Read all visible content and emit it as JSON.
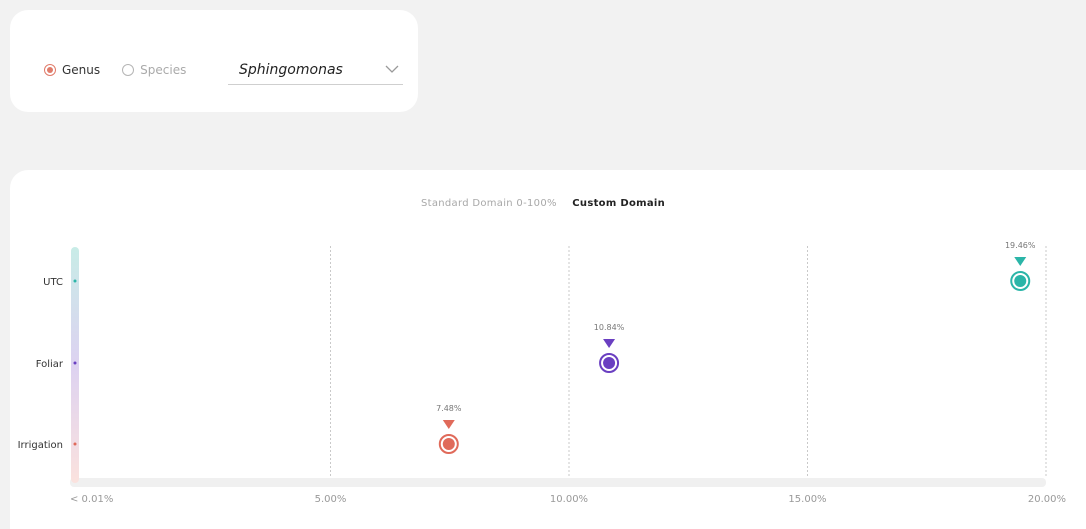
{
  "filters": {
    "radios": [
      {
        "label": "Genus",
        "checked": true
      },
      {
        "label": "Species",
        "checked": false
      }
    ],
    "select_value": "Sphingomonas"
  },
  "domain_toggle": {
    "standard": "Standard Domain 0-100%",
    "custom": "Custom Domain",
    "active": "custom"
  },
  "chart_data": {
    "type": "scatter",
    "xlim": [
      0,
      20
    ],
    "x_ticks": [
      "< 0.01%",
      "5.00%",
      "10.00%",
      "15.00%",
      "20.00%"
    ],
    "x_tick_values": [
      0,
      5,
      10,
      15,
      20
    ],
    "grid": true,
    "categories": [
      "UTC",
      "Foliar",
      "Irrigation"
    ],
    "series": [
      {
        "category": "UTC",
        "value": 19.46,
        "label": "19.46%",
        "color": "#2bb5a8"
      },
      {
        "category": "Foliar",
        "value": 10.84,
        "label": "10.84%",
        "color": "#6a3fc1"
      },
      {
        "category": "Irrigation",
        "value": 7.48,
        "label": "7.48%",
        "color": "#e06a5a"
      }
    ]
  }
}
